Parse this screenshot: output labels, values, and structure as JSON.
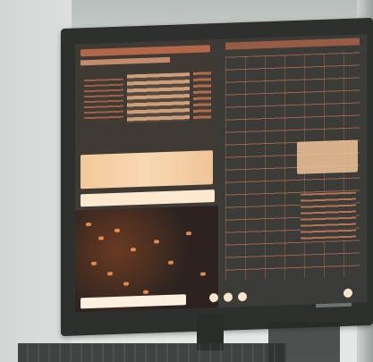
{
  "photo": {
    "subject": "",
    "colors": {
      "wall": "#d6d9d6",
      "monitor_bezel": "#2d302d",
      "screen_bg": "#3a3d3a",
      "accent_orange": "#d98a5e",
      "highlight": "#f3c89a"
    }
  }
}
